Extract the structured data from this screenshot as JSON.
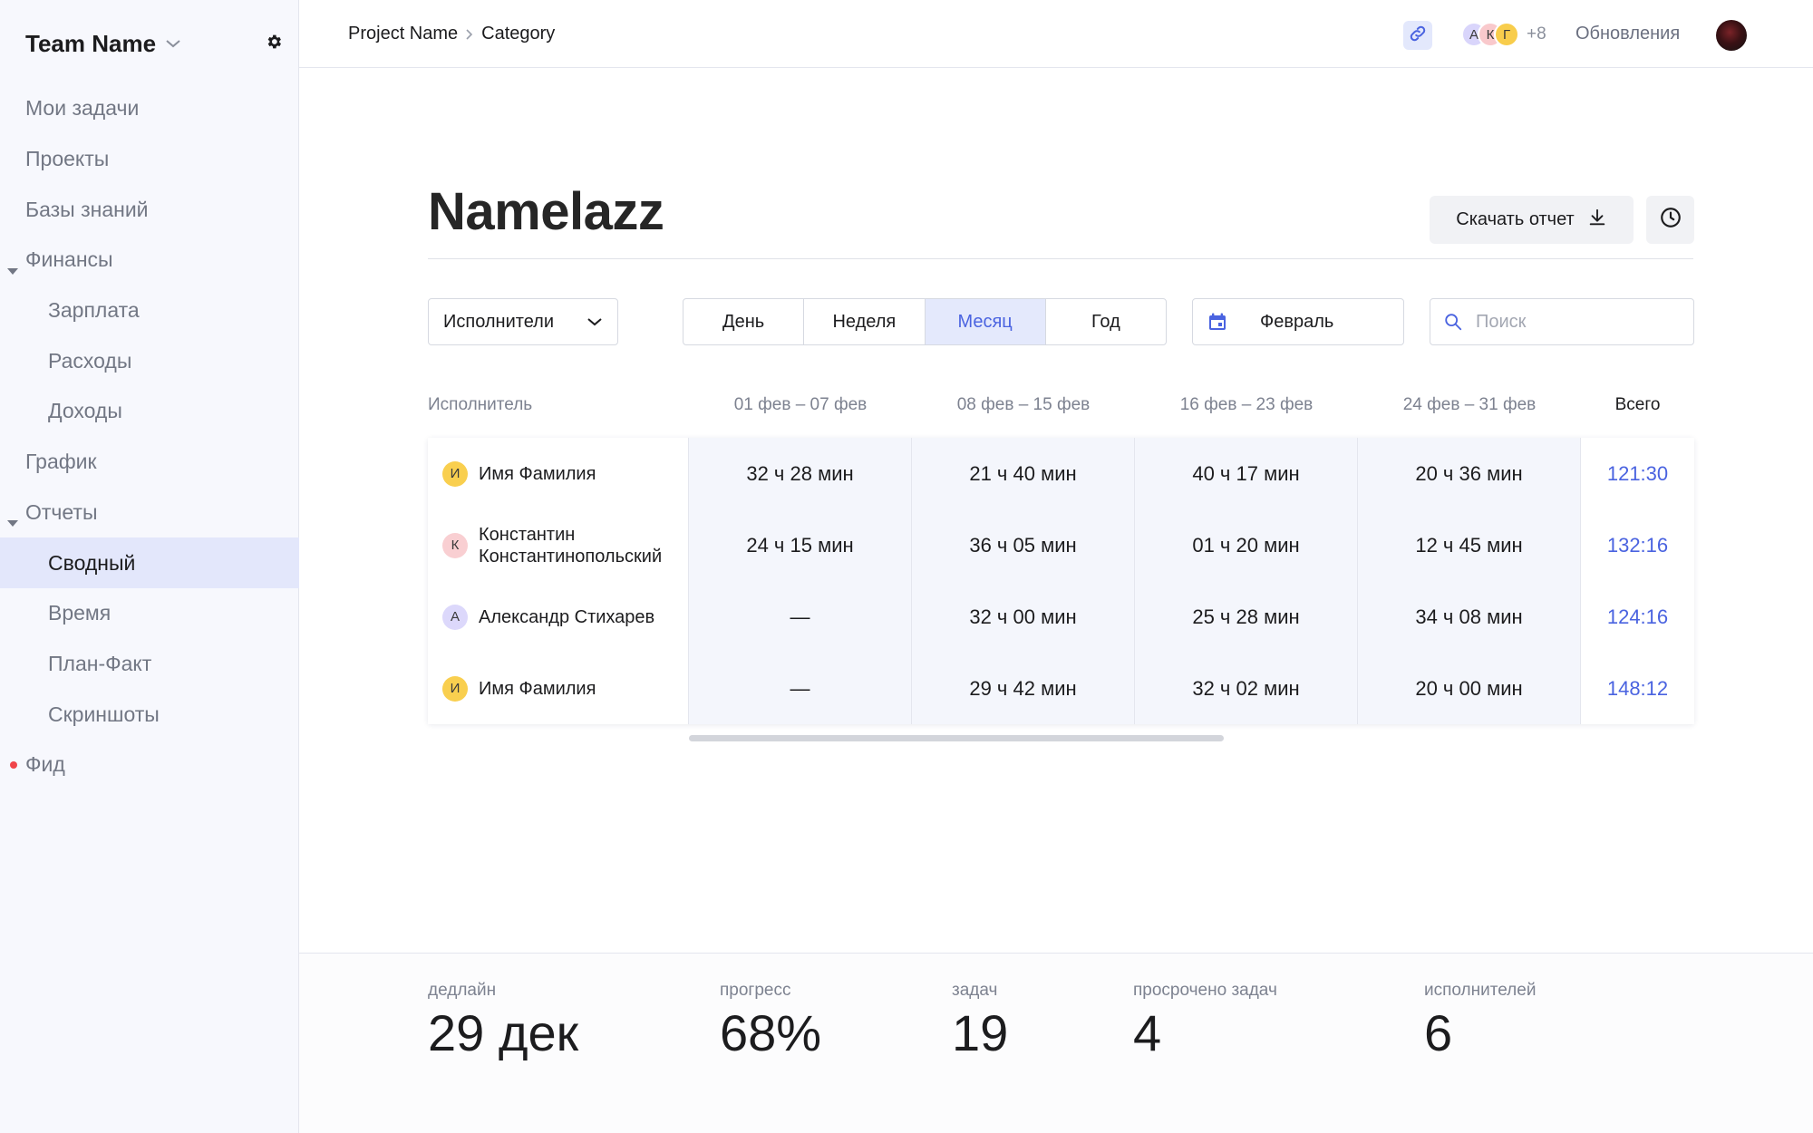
{
  "sidebar": {
    "team_name": "Team Name",
    "items": [
      {
        "label": "Мои задачи"
      },
      {
        "label": "Проекты"
      },
      {
        "label": "Базы знаний"
      },
      {
        "label": "Финансы"
      },
      {
        "label": "Зарплата"
      },
      {
        "label": "Расходы"
      },
      {
        "label": "Доходы"
      },
      {
        "label": "График"
      },
      {
        "label": "Отчеты"
      },
      {
        "label": "Сводный"
      },
      {
        "label": "Время"
      },
      {
        "label": "План-Факт"
      },
      {
        "label": "Скриншоты"
      },
      {
        "label": "Фид"
      }
    ],
    "active_item": "Сводный",
    "notification_color": "#f0454a"
  },
  "topbar": {
    "breadcrumb": [
      "Project Name",
      "Category"
    ],
    "members": [
      {
        "initial": "А",
        "color": "#d9d5fb"
      },
      {
        "initial": "К",
        "color": "#f9c9cc"
      },
      {
        "initial": "Г",
        "color": "#f8cd4c"
      }
    ],
    "more_members": "+8",
    "updates_label": "Обновления",
    "link_icon": "link-icon"
  },
  "page": {
    "title": "Namelazz",
    "download_label": "Скачать отчет",
    "history_icon": "clock-icon"
  },
  "filters": {
    "group_by": "Исполнители",
    "periods": [
      "День",
      "Неделя",
      "Месяц",
      "Год"
    ],
    "active_period": "Месяц",
    "date": "Февраль",
    "search_placeholder": "Поиск",
    "search_value": ""
  },
  "table": {
    "columns": [
      "Исполнитель",
      "01 фев – 07 фев",
      "08 фев – 15 фев",
      "16 фев – 23 фев",
      "24 фев – 31 фев",
      "Всего"
    ],
    "rows": [
      {
        "initial": "И",
        "avatar_color": "#f9cf4f",
        "name": "Имя Фамилия",
        "cells": [
          "32 ч 28 мин",
          "21 ч 40 мин",
          "40 ч 17 мин",
          "20 ч 36 мин"
        ],
        "total": "121:30"
      },
      {
        "initial": "К",
        "avatar_color": "#f9cfd2",
        "name": "Константин Константинопольский",
        "cells": [
          "24 ч 15 мин",
          "36 ч 05 мин",
          "01 ч 20 мин",
          "12 ч 45 мин"
        ],
        "total": "132:16"
      },
      {
        "initial": "А",
        "avatar_color": "#dcd8fb",
        "name": "Александр Стихарев",
        "cells": [
          "—",
          "32 ч 00 мин",
          "25 ч 28 мин",
          "34 ч 08 мин"
        ],
        "total": "124:16"
      },
      {
        "initial": "И",
        "avatar_color": "#f9cf4f",
        "name": "Имя Фамилия",
        "cells": [
          "—",
          "29 ч 42 мин",
          "32 ч 02 мин",
          "20 ч 00 мин"
        ],
        "total": "148:12"
      }
    ]
  },
  "stats": [
    {
      "label": "дедлайн",
      "value": "29 дек"
    },
    {
      "label": "прогресс",
      "value": "68%"
    },
    {
      "label": "задач",
      "value": "19"
    },
    {
      "label": "просрочено задач",
      "value": "4"
    },
    {
      "label": "исполнителей",
      "value": "6"
    }
  ],
  "colors": {
    "accent": "#4a63e0",
    "sidebar_bg": "#f7f8fd",
    "active_nav_bg": "#e3e7fb",
    "period_cell_bg": "#f4f6fc"
  }
}
